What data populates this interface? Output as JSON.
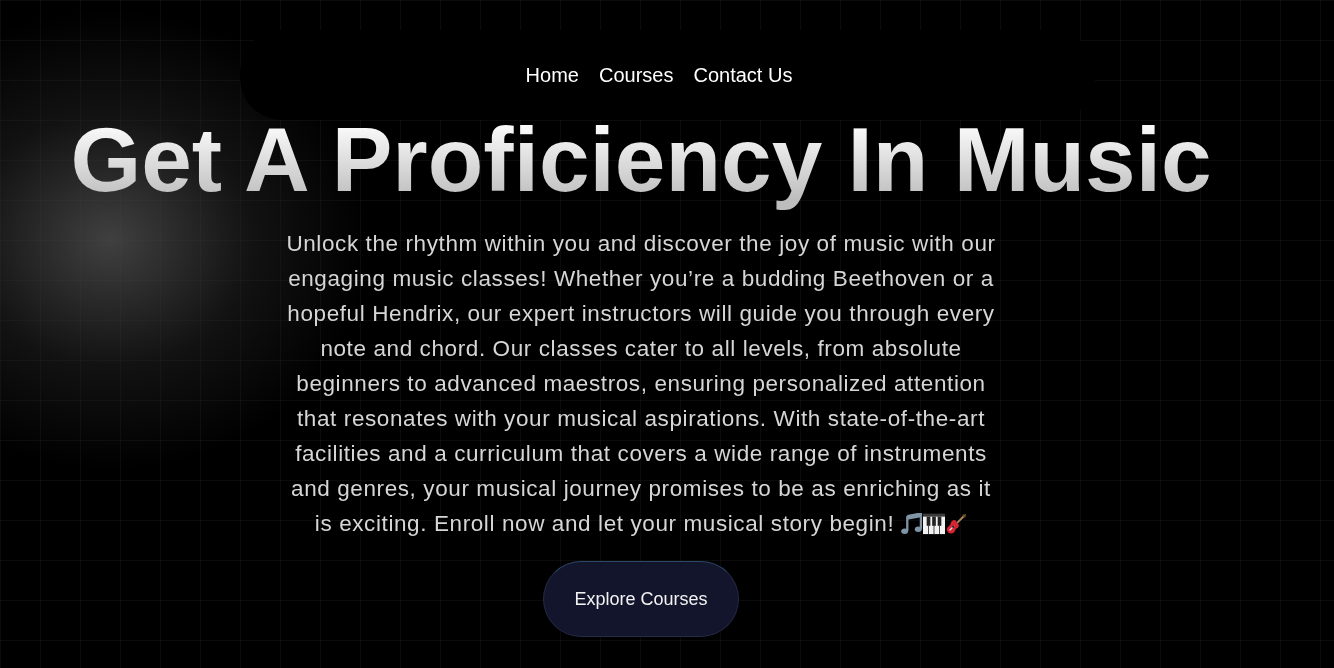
{
  "nav": {
    "links": [
      {
        "label": "Home"
      },
      {
        "label": "Courses"
      },
      {
        "label": "Contact Us"
      }
    ]
  },
  "hero": {
    "title": "Get A Proficiency In Music",
    "description": "Unlock the rhythm within you and discover the joy of music with our engaging music classes! Whether you’re a budding Beethoven or a hopeful Hendrix, our expert instructors will guide you through every note and chord. Our classes cater to all levels, from absolute beginners to advanced maestros, ensuring personalized attention that resonates with your musical aspirations. With state-of-the-art facilities and a curriculum that covers a wide range of instruments and genres, your musical journey promises to be as enriching as it is exciting. Enroll now and let your musical story begin!",
    "button": "Explore Courses"
  }
}
